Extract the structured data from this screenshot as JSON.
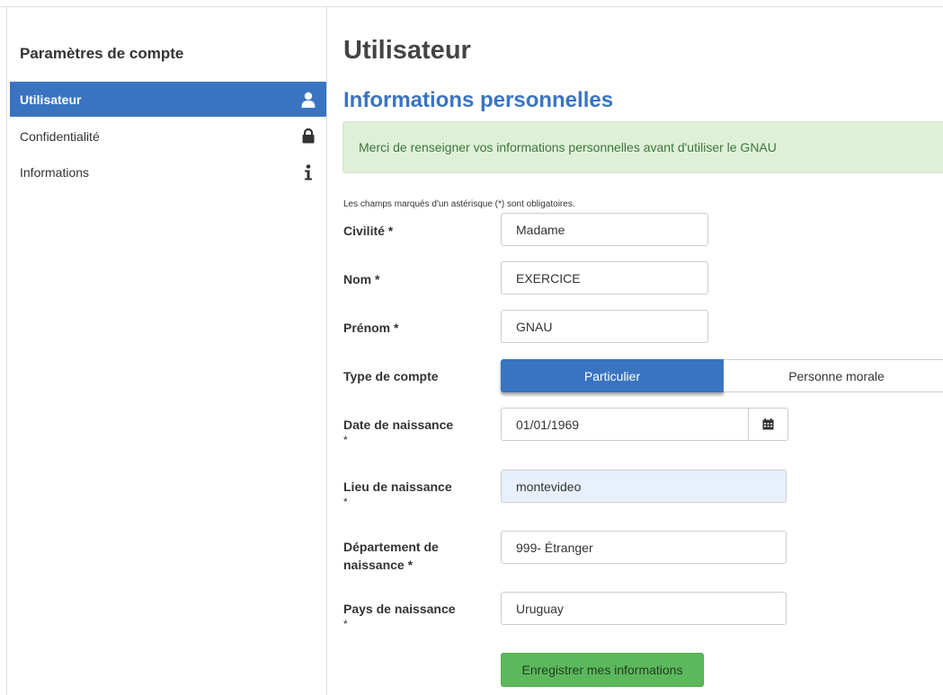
{
  "sidebar": {
    "title": "Paramètres de compte",
    "items": [
      {
        "label": "Utilisateur",
        "icon": "user-icon",
        "active": true
      },
      {
        "label": "Confidentialité",
        "icon": "lock-icon",
        "active": false
      },
      {
        "label": "Informations",
        "icon": "info-icon",
        "active": false
      }
    ]
  },
  "main": {
    "title": "Utilisateur",
    "section_title": "Informations personnelles",
    "alert": "Merci de renseigner vos informations personnelles avant d'utiliser le GNAU",
    "required_note": "Les champs marqués d'un astérisque (*) sont obligatoires."
  },
  "form": {
    "civilite": {
      "label": "Civilité *",
      "value": "Madame"
    },
    "nom": {
      "label": "Nom *",
      "value": "EXERCICE"
    },
    "prenom": {
      "label": "Prénom *",
      "value": "GNAU"
    },
    "type_compte": {
      "label": "Type de compte",
      "options": [
        "Particulier",
        "Personne morale"
      ],
      "selected": "Particulier"
    },
    "date_naissance": {
      "label_line1": "Date de naissance",
      "label_line2": "*",
      "value": "01/01/1969"
    },
    "lieu_naissance": {
      "label_line1": "Lieu de naissance",
      "label_line2": "*",
      "value": "montevideo"
    },
    "departement": {
      "label_line1": "Département de",
      "label_line2": "naissance *",
      "value": "999- Étranger"
    },
    "pays": {
      "label_line1": "Pays de naissance",
      "label_line2": "*",
      "value": "Uruguay"
    },
    "submit_label": "Enregistrer mes informations"
  },
  "colors": {
    "primary": "#3a74c1",
    "success": "#5cb85c",
    "alert_bg": "#dff0d8",
    "alert_text": "#3c763d"
  }
}
